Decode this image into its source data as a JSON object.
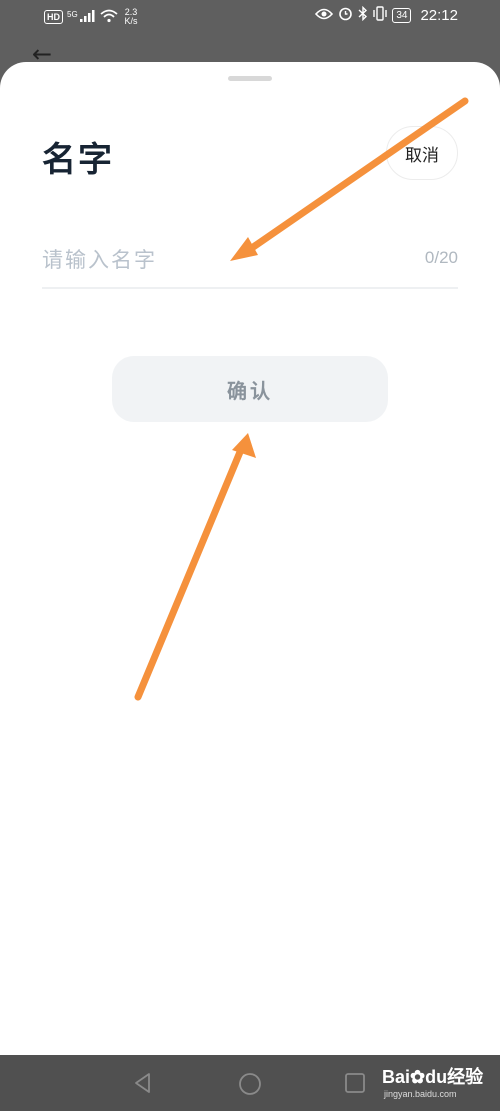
{
  "status_bar": {
    "hd": "HD",
    "signal": "5G",
    "speed_value": "2.3",
    "speed_unit": "K/s",
    "battery": "34",
    "time": "22:12"
  },
  "sheet": {
    "title": "名字",
    "cancel_label": "取消",
    "input_placeholder": "请输入名字",
    "input_value": "",
    "counter": "0/20",
    "confirm_label": "确认"
  },
  "watermark": {
    "brand": "Bai",
    "brand_tail": "du经验",
    "site": "jingyan.baidu.com"
  },
  "colors": {
    "annotation_arrow": "#f5913c",
    "title": "#172433",
    "placeholder": "#b9c2cc"
  }
}
